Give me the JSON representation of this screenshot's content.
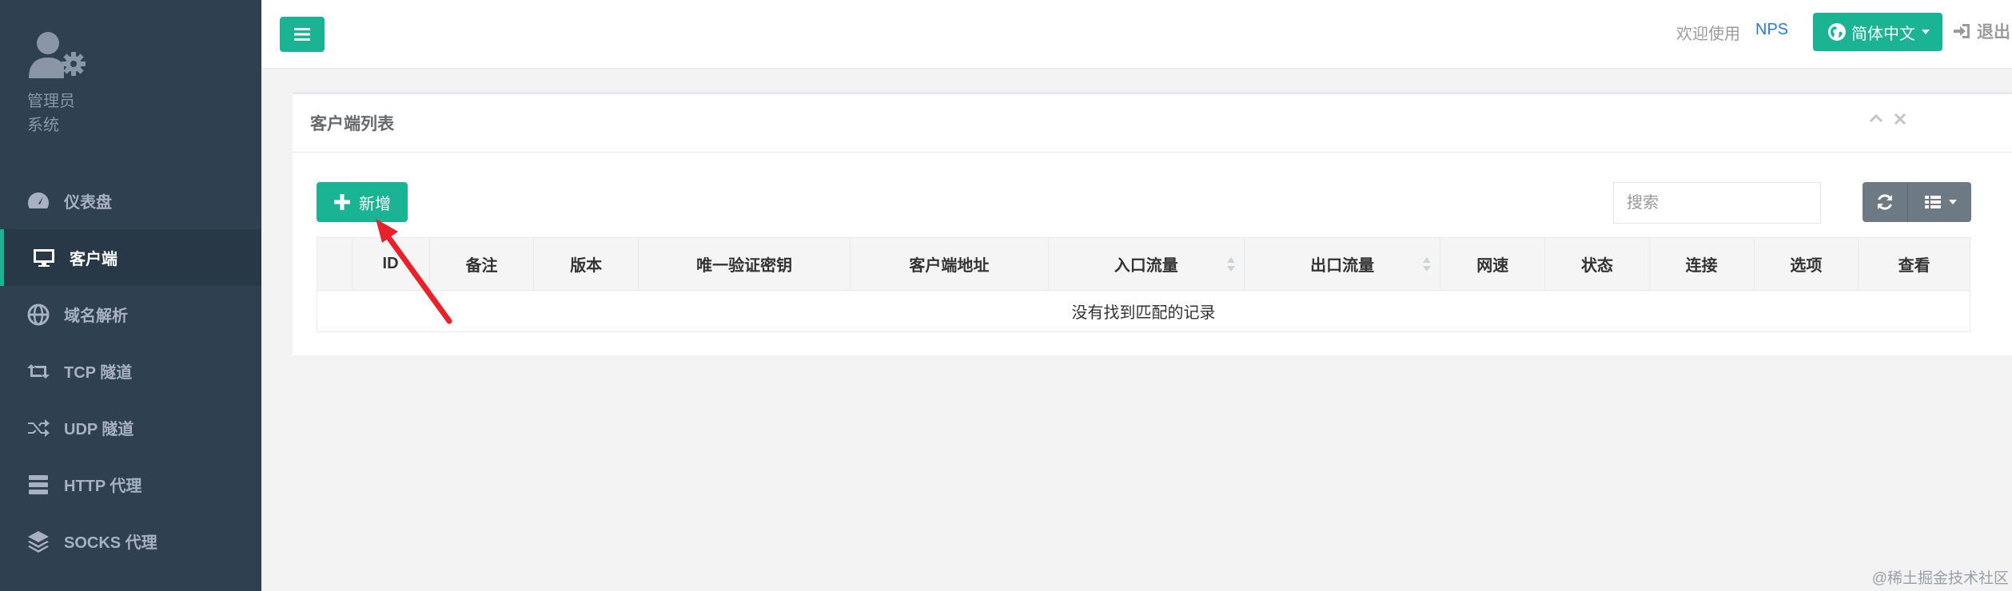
{
  "colors": {
    "sidebar_bg": "#2f4050",
    "accent": "#1ab394",
    "link": "#2a7ad3",
    "tool_btn": "#6d7a83"
  },
  "sidebar": {
    "profile": {
      "name": "管理员",
      "role": "系统"
    },
    "items": [
      {
        "label": "仪表盘",
        "icon": "dashboard-icon",
        "active": false
      },
      {
        "label": "客户端",
        "icon": "monitor-icon",
        "active": true
      },
      {
        "label": "域名解析",
        "icon": "globe-icon",
        "active": false
      },
      {
        "label": "TCP 隧道",
        "icon": "retweet-icon",
        "active": false
      },
      {
        "label": "UDP 隧道",
        "icon": "shuffle-icon",
        "active": false
      },
      {
        "label": "HTTP 代理",
        "icon": "server-icon",
        "active": false
      },
      {
        "label": "SOCKS 代理",
        "icon": "layers-icon",
        "active": false
      }
    ]
  },
  "topbar": {
    "welcome": "欢迎使用",
    "brand": "NPS",
    "language": "简体中文",
    "logout": "退出"
  },
  "panel": {
    "title": "客户端列表",
    "add_label": "新增",
    "search_placeholder": "搜索",
    "columns": [
      "",
      "ID",
      "备注",
      "版本",
      "唯一验证密钥",
      "客户端地址",
      "入口流量",
      "出口流量",
      "网速",
      "状态",
      "连接",
      "选项",
      "查看"
    ],
    "empty_text": "没有找到匹配的记录"
  },
  "watermark": "@稀土掘金技术社区"
}
